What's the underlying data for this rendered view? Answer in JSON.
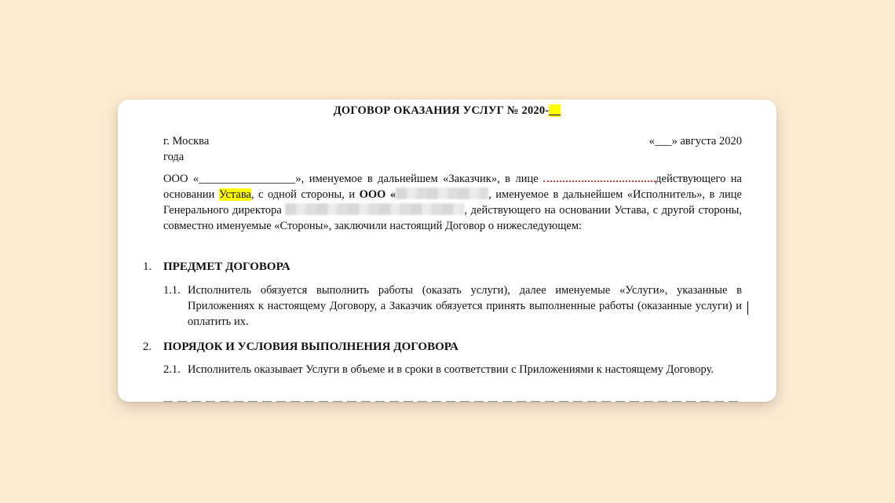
{
  "document": {
    "title_prefix": "ДОГОВОР ОКАЗАНИЯ УСЛУГ № 2020-",
    "title_highlight": "__",
    "city": "г. Москва",
    "date_text": "«___» августа 2020",
    "date_suffix": "года",
    "intro": {
      "part1": "ООО «_________________», именуемое в дальнейшем «Заказчик», в лице ",
      "part2": "действующего на основании ",
      "highlight": "Устава",
      "part3": ", с одной стороны, и ",
      "bold_org": "ООО «",
      "part4": ", именуемое в дальнейшем «Исполнитель», в лице Генерального директора ",
      "part5": ", действующего на основании Устава, с другой стороны, совместно именуемые «Стороны», заключили настоящий Договор о нижеследующем:"
    },
    "sections": [
      {
        "num": "1.",
        "heading": "ПРЕДМЕТ ДОГОВОРА",
        "items": [
          {
            "num": "1.1.",
            "text": "Исполнитель обязуется выполнить работы (оказать услуги), далее именуемые «Услуги», указанные в Приложениях к настоящему Договору, а Заказчик обязуется принять выполненные работы (оказанные услуги) и оплатить их."
          }
        ]
      },
      {
        "num": "2.",
        "heading": "ПОРЯДОК И УСЛОВИЯ ВЫПОЛНЕНИЯ ДОГОВОРА",
        "items": [
          {
            "num": "2.1.",
            "text": "Исполнитель оказывает Услуги в объеме и в сроки в соответствии с Приложениями к настоящему Договору."
          }
        ]
      }
    ]
  },
  "colors": {
    "background": "#fdebd1",
    "highlight": "#ffff00",
    "spellcheck": "#dd3333"
  }
}
